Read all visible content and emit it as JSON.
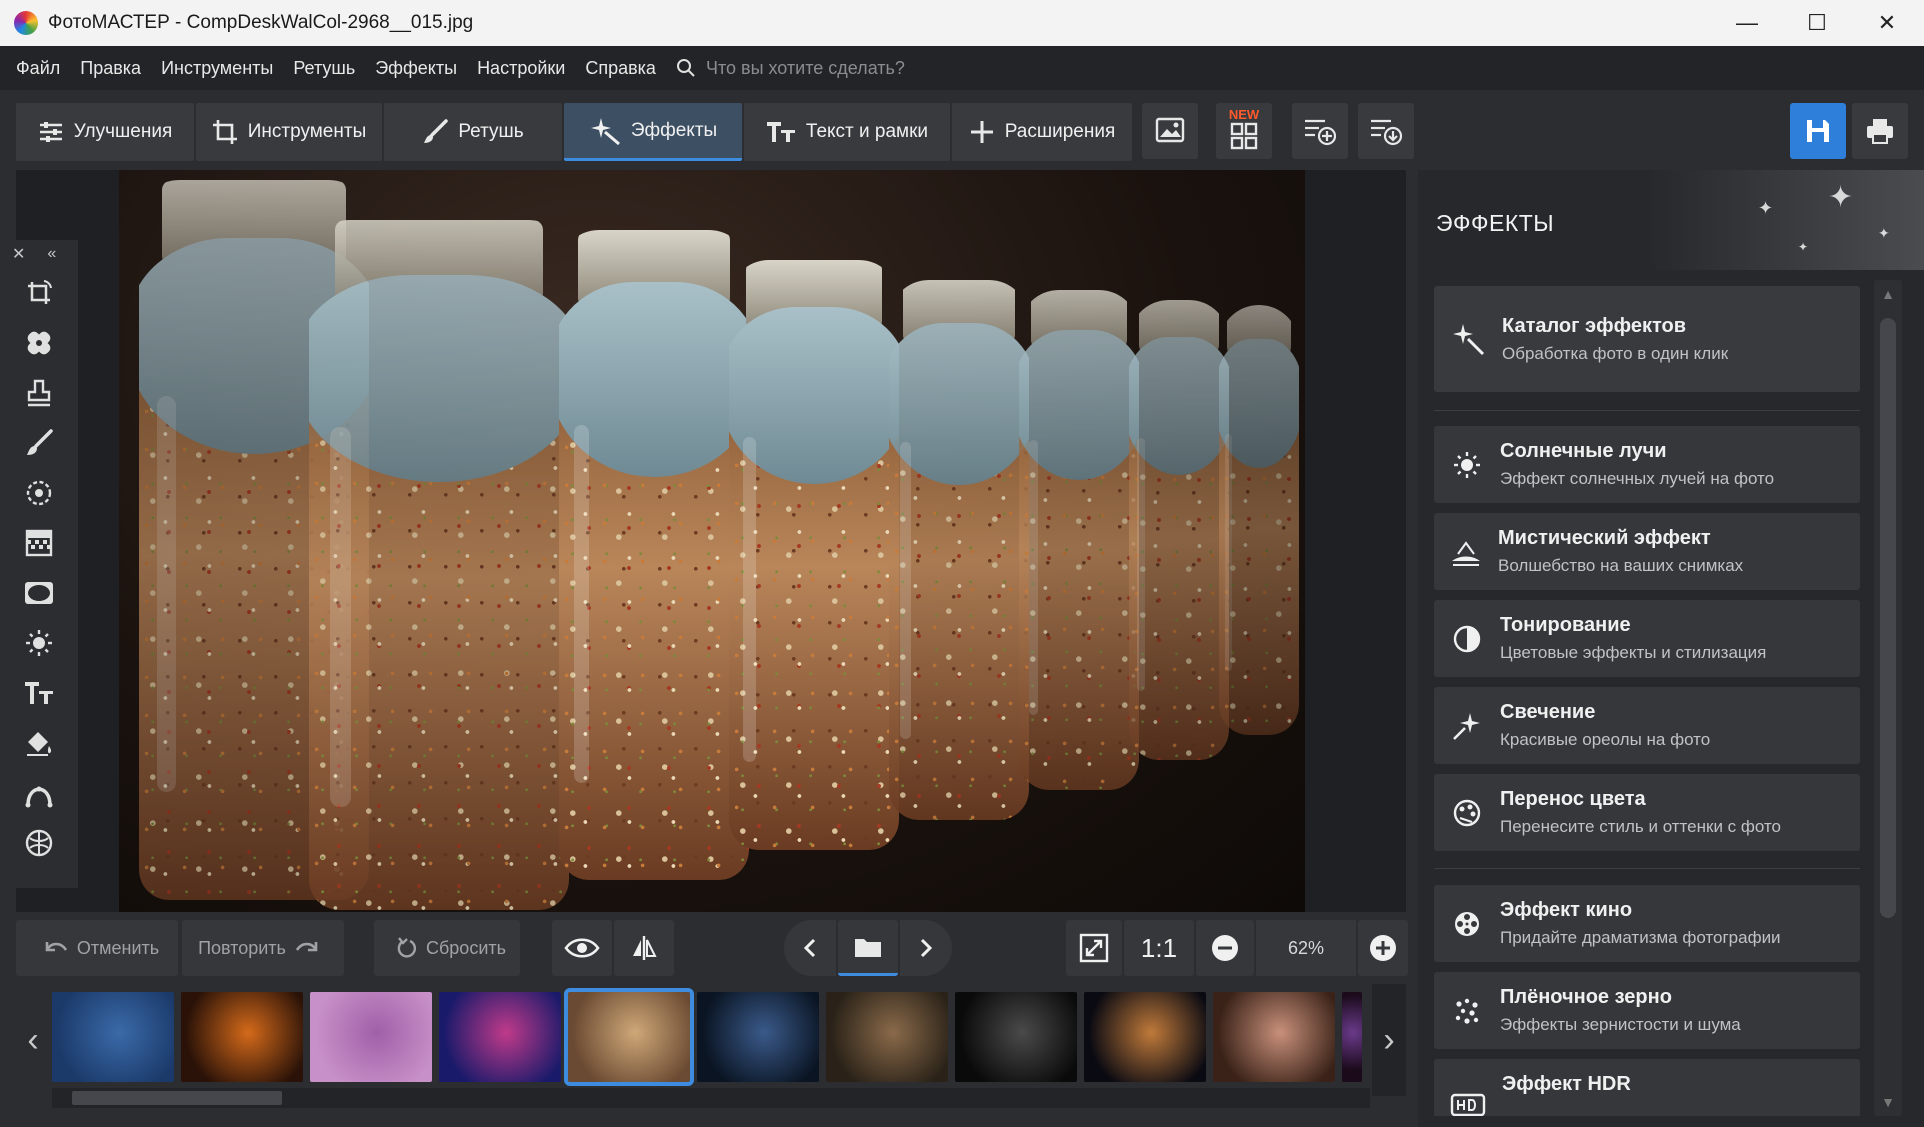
{
  "window": {
    "title": "ФотоМАСТЕР - CompDeskWalCol-2968__015.jpg",
    "minimize": "—",
    "maximize": "☐",
    "close": "✕"
  },
  "menu": {
    "items": [
      "Файл",
      "Правка",
      "Инструменты",
      "Ретушь",
      "Эффекты",
      "Настройки",
      "Справка"
    ],
    "search_placeholder": "Что вы хотите сделать?"
  },
  "tabs": [
    {
      "label": "Улучшения",
      "icon": "sliders-icon"
    },
    {
      "label": "Инструменты",
      "icon": "crop-icon"
    },
    {
      "label": "Ретушь",
      "icon": "brush-icon"
    },
    {
      "label": "Эффекты",
      "icon": "sparkle-icon",
      "active": true
    },
    {
      "label": "Текст и рамки",
      "icon": "text-icon"
    },
    {
      "label": "Расширения",
      "icon": "plus-icon"
    }
  ],
  "toolbar_extra": {
    "new_badge": "NEW"
  },
  "tool_strip": {
    "close": "✕",
    "collapse": "«",
    "tools": [
      "rotate-icon",
      "patch-icon",
      "stamp-icon",
      "brush-icon",
      "target-icon",
      "gradient-icon",
      "vignette-icon",
      "sun-icon",
      "text-icon",
      "fill-icon",
      "curve-icon",
      "mask-icon"
    ]
  },
  "controls": {
    "undo": "Отменить",
    "redo": "Повторить",
    "reset": "Сбросить",
    "one_to_one": "1:1",
    "zoom": "62%"
  },
  "filmstrip": {
    "prev": "‹",
    "next": "›",
    "active_index": 4,
    "thumbs": [
      {
        "colors": [
          "#1b3a6a",
          "#3a6aa8"
        ]
      },
      {
        "colors": [
          "#2a1208",
          "#d46a1a"
        ]
      },
      {
        "colors": [
          "#c890c8",
          "#a060a8"
        ]
      },
      {
        "colors": [
          "#1a1a6a",
          "#c03a8a"
        ]
      },
      {
        "colors": [
          "#6a4a32",
          "#cfa878"
        ]
      },
      {
        "colors": [
          "#0a1422",
          "#3a5a8a"
        ]
      },
      {
        "colors": [
          "#2a2218",
          "#8a6a4a"
        ]
      },
      {
        "colors": [
          "#0a0a0a",
          "#4a4a4a"
        ]
      },
      {
        "colors": [
          "#0a0a12",
          "#c07a3a"
        ]
      },
      {
        "colors": [
          "#3a2218",
          "#c8907a"
        ]
      },
      {
        "colors": [
          "#1a0a1a",
          "#6a3a8a"
        ]
      }
    ]
  },
  "panel": {
    "title": "ЭФФЕКТЫ",
    "catalog": {
      "title": "Каталог эффектов",
      "subtitle": "Обработка фото в один клик",
      "icon": "magic-wand-icon"
    },
    "effects": [
      {
        "title": "Солнечные лучи",
        "subtitle": "Эффект солнечных лучей на фото",
        "icon": "sun-icon"
      },
      {
        "title": "Мистический эффект",
        "subtitle": "Волшебство на ваших снимках",
        "icon": "mystic-icon"
      },
      {
        "title": "Тонирование",
        "subtitle": "Цветовые эффекты и стилизация",
        "icon": "toning-icon"
      },
      {
        "title": "Свечение",
        "subtitle": "Красивые ореолы на фото",
        "icon": "glow-icon"
      },
      {
        "title": "Перенос цвета",
        "subtitle": "Перенесите стиль и оттенки с фото",
        "icon": "color-transfer-icon"
      }
    ],
    "effects2": [
      {
        "title": "Эффект кино",
        "subtitle": "Придайте драматизма фотографии",
        "icon": "film-reel-icon"
      },
      {
        "title": "Плёночное зерно",
        "subtitle": "Эффекты зернистости и шума",
        "icon": "grain-icon"
      },
      {
        "title": "Эффект HDR",
        "subtitle": "",
        "icon": "hdr-icon"
      }
    ]
  }
}
